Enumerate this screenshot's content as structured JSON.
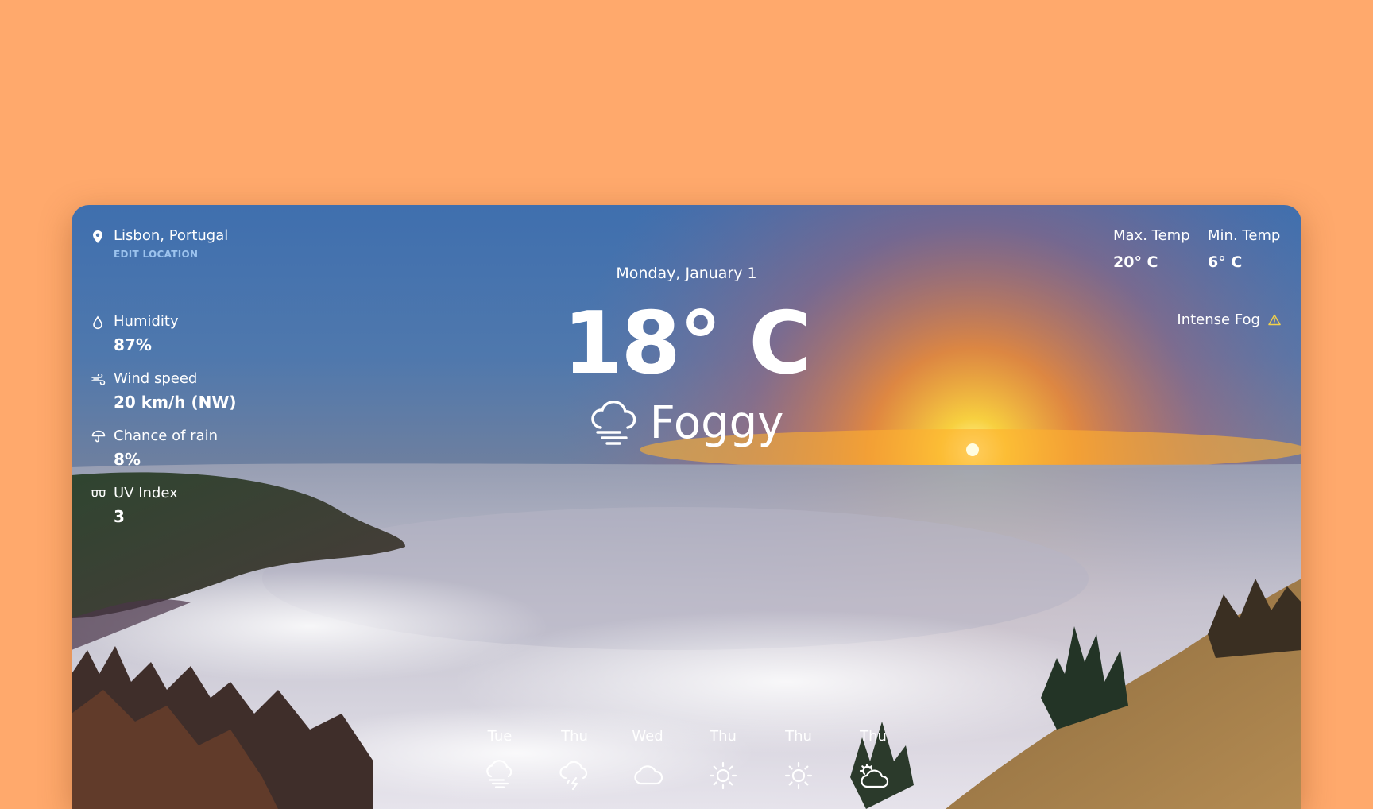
{
  "location": {
    "name": "Lisbon, Portugal",
    "edit_label": "EDIT LOCATION",
    "icon": "location-pin-icon"
  },
  "stats": [
    {
      "label": "Humidity",
      "value": "87%",
      "icon": "droplet-icon"
    },
    {
      "label": "Wind speed",
      "value": "20 km/h (NW)",
      "icon": "wind-icon"
    },
    {
      "label": "Chance of rain",
      "value": "8%",
      "icon": "umbrella-icon"
    },
    {
      "label": "UV Index",
      "value": "3",
      "icon": "sunglasses-icon"
    }
  ],
  "current": {
    "date": "Monday, January 1",
    "temperature": "18° C",
    "condition": "Foggy",
    "condition_icon": "fog-icon"
  },
  "temps": {
    "max_label": "Max. Temp",
    "max_value": "20° C",
    "min_label": "Min. Temp",
    "min_value": "6° C"
  },
  "alert": {
    "label": "Intense Fog",
    "icon": "warning-icon",
    "color": "#F2D14A"
  },
  "forecast": [
    {
      "day": "Tue",
      "icon": "fog-icon"
    },
    {
      "day": "Thu",
      "icon": "thunderstorm-icon"
    },
    {
      "day": "Wed",
      "icon": "cloud-icon"
    },
    {
      "day": "Thu",
      "icon": "sun-icon"
    },
    {
      "day": "Thu",
      "icon": "sun-icon"
    },
    {
      "day": "Thu",
      "icon": "partly-cloudy-icon"
    }
  ],
  "colors": {
    "page_background": "#FFA96C",
    "text": "#FFFFFF",
    "edit_link": "#9CC3EE",
    "alert": "#F2D14A"
  }
}
